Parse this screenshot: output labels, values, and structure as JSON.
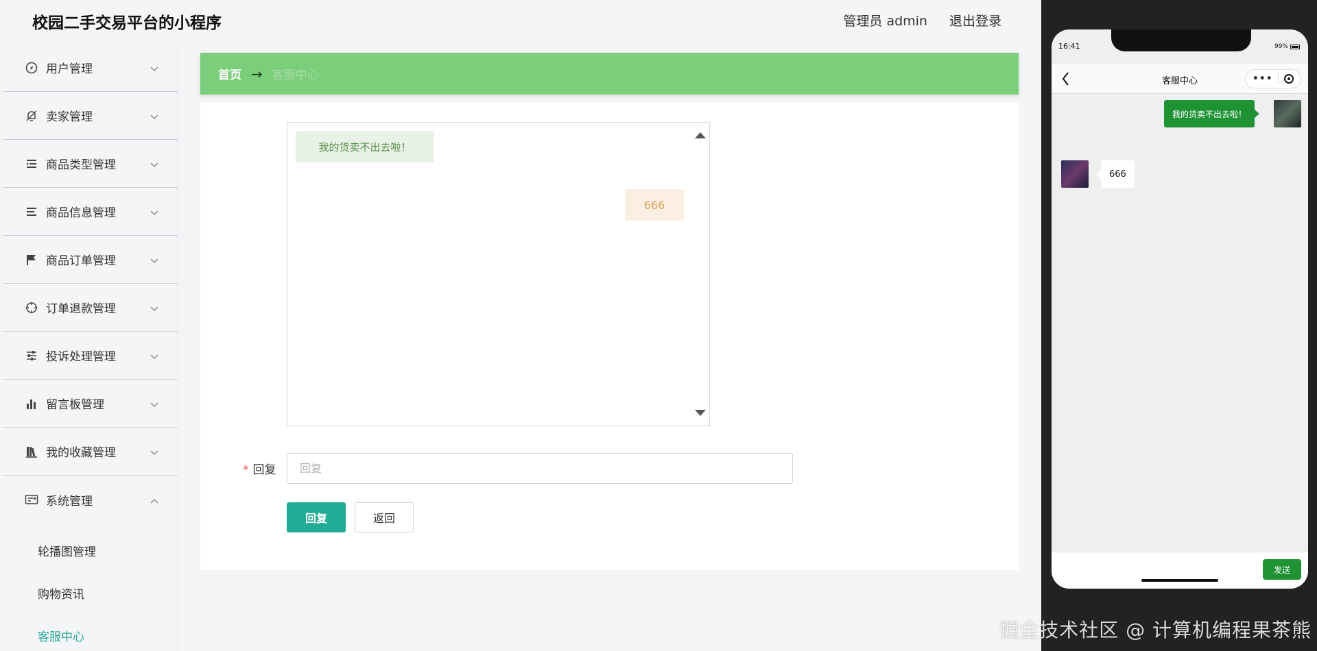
{
  "header": {
    "title": "校园二手交易平台的小程序",
    "user": "管理员 admin",
    "logout": "退出登录"
  },
  "sidebar": {
    "items": [
      {
        "label": "用户管理",
        "icon": "compass-icon"
      },
      {
        "label": "卖家管理",
        "icon": "bell-off-icon"
      },
      {
        "label": "商品类型管理",
        "icon": "list-icon"
      },
      {
        "label": "商品信息管理",
        "icon": "menu-icon"
      },
      {
        "label": "商品订单管理",
        "icon": "flag-icon"
      },
      {
        "label": "订单退款管理",
        "icon": "crosshair-icon"
      },
      {
        "label": "投诉处理管理",
        "icon": "sliders-icon"
      },
      {
        "label": "留言板管理",
        "icon": "bar-chart-icon"
      },
      {
        "label": "我的收藏管理",
        "icon": "library-icon"
      },
      {
        "label": "系统管理",
        "icon": "id-card-icon"
      }
    ],
    "submenu": [
      {
        "label": "轮播图管理"
      },
      {
        "label": "购物资讯"
      },
      {
        "label": "客服中心"
      }
    ]
  },
  "breadcrumb": {
    "home": "首页",
    "arrow": "→",
    "current": "客服中心"
  },
  "chat": {
    "messages": [
      {
        "side": "left",
        "text": "我的货卖不出去啦！"
      },
      {
        "side": "right",
        "text": "666"
      }
    ]
  },
  "form": {
    "reply_label": "回复",
    "required_mark": "*",
    "reply_placeholder": "回复",
    "reply_value": "",
    "submit_label": "回复",
    "back_label": "返回"
  },
  "phone": {
    "time": "16:41",
    "battery": "99%",
    "title": "客服中心",
    "capsule_dots": "•••",
    "messages": [
      {
        "side": "right",
        "text": "我的货卖不出去啦！"
      },
      {
        "side": "left",
        "text": "666"
      }
    ],
    "send_label": "发送"
  },
  "watermark": "掘金技术社区 @ 计算机编程果茶熊",
  "colors": {
    "breadcrumb_bg": "#7bcf7b",
    "active_sub": "#2aa59a",
    "reply_btn": "#20ac94",
    "phone_send": "#1f9234"
  }
}
